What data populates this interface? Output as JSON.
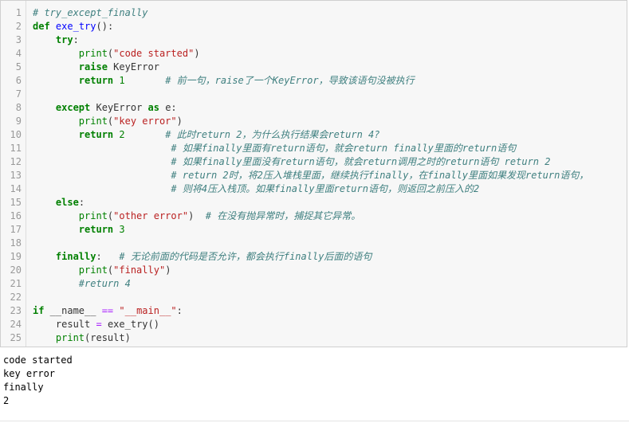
{
  "code_cell": {
    "line_numbers": [
      "1",
      "2",
      "3",
      "4",
      "5",
      "6",
      "7",
      "8",
      "9",
      "10",
      "11",
      "12",
      "13",
      "14",
      "15",
      "16",
      "17",
      "18",
      "19",
      "20",
      "21",
      "22",
      "23",
      "24",
      "25"
    ],
    "lines": [
      [
        {
          "t": "# try_except_finally",
          "c": "cm"
        }
      ],
      [
        {
          "t": "def",
          "c": "kw"
        },
        {
          "t": " ",
          "c": ""
        },
        {
          "t": "exe_try",
          "c": "fn"
        },
        {
          "t": "():",
          "c": ""
        }
      ],
      [
        {
          "t": "    ",
          "c": ""
        },
        {
          "t": "try",
          "c": "kw"
        },
        {
          "t": ":",
          "c": ""
        }
      ],
      [
        {
          "t": "        ",
          "c": ""
        },
        {
          "t": "print",
          "c": "bi"
        },
        {
          "t": "(",
          "c": ""
        },
        {
          "t": "\"code started\"",
          "c": "str"
        },
        {
          "t": ")",
          "c": ""
        }
      ],
      [
        {
          "t": "        ",
          "c": ""
        },
        {
          "t": "raise",
          "c": "kw"
        },
        {
          "t": " KeyError",
          "c": ""
        }
      ],
      [
        {
          "t": "        ",
          "c": ""
        },
        {
          "t": "return",
          "c": "kw"
        },
        {
          "t": " ",
          "c": ""
        },
        {
          "t": "1",
          "c": "num"
        },
        {
          "t": "       ",
          "c": ""
        },
        {
          "t": "# 前一句，raise了一个KeyError，导致该语句没被执行",
          "c": "cm"
        }
      ],
      [],
      [
        {
          "t": "    ",
          "c": ""
        },
        {
          "t": "except",
          "c": "kw"
        },
        {
          "t": " KeyError ",
          "c": ""
        },
        {
          "t": "as",
          "c": "kw"
        },
        {
          "t": " e:",
          "c": ""
        }
      ],
      [
        {
          "t": "        ",
          "c": ""
        },
        {
          "t": "print",
          "c": "bi"
        },
        {
          "t": "(",
          "c": ""
        },
        {
          "t": "\"key error\"",
          "c": "str"
        },
        {
          "t": ")",
          "c": ""
        }
      ],
      [
        {
          "t": "        ",
          "c": ""
        },
        {
          "t": "return",
          "c": "kw"
        },
        {
          "t": " ",
          "c": ""
        },
        {
          "t": "2",
          "c": "num"
        },
        {
          "t": "       ",
          "c": ""
        },
        {
          "t": "# 此时return 2，为什么执行结果会return 4?",
          "c": "cm"
        }
      ],
      [
        {
          "t": "                        ",
          "c": ""
        },
        {
          "t": "# 如果finally里面有return语句，就会return finally里面的return语句",
          "c": "cm"
        }
      ],
      [
        {
          "t": "                        ",
          "c": ""
        },
        {
          "t": "# 如果finally里面没有return语句，就会return调用之时的return语句 return 2",
          "c": "cm"
        }
      ],
      [
        {
          "t": "                        ",
          "c": ""
        },
        {
          "t": "# return 2时，将2压入堆栈里面，继续执行finally，在finally里面如果发现return语句，",
          "c": "cm"
        }
      ],
      [
        {
          "t": "                        ",
          "c": ""
        },
        {
          "t": "# 则将4压入栈顶。如果finally里面return语句，则返回之前压入的2",
          "c": "cm"
        }
      ],
      [
        {
          "t": "    ",
          "c": ""
        },
        {
          "t": "else",
          "c": "kw"
        },
        {
          "t": ":",
          "c": ""
        }
      ],
      [
        {
          "t": "        ",
          "c": ""
        },
        {
          "t": "print",
          "c": "bi"
        },
        {
          "t": "(",
          "c": ""
        },
        {
          "t": "\"other error\"",
          "c": "str"
        },
        {
          "t": ")  ",
          "c": ""
        },
        {
          "t": "# 在没有抛异常时，捕捉其它异常。",
          "c": "cm"
        }
      ],
      [
        {
          "t": "        ",
          "c": ""
        },
        {
          "t": "return",
          "c": "kw"
        },
        {
          "t": " ",
          "c": ""
        },
        {
          "t": "3",
          "c": "num"
        }
      ],
      [],
      [
        {
          "t": "    ",
          "c": ""
        },
        {
          "t": "finally",
          "c": "kw"
        },
        {
          "t": ":   ",
          "c": ""
        },
        {
          "t": "# 无论前面的代码是否允许，都会执行finally后面的语句",
          "c": "cm"
        }
      ],
      [
        {
          "t": "        ",
          "c": ""
        },
        {
          "t": "print",
          "c": "bi"
        },
        {
          "t": "(",
          "c": ""
        },
        {
          "t": "\"finally\"",
          "c": "str"
        },
        {
          "t": ")",
          "c": ""
        }
      ],
      [
        {
          "t": "        ",
          "c": ""
        },
        {
          "t": "#return 4",
          "c": "cm"
        }
      ],
      [],
      [
        {
          "t": "if",
          "c": "kw"
        },
        {
          "t": " __name__ ",
          "c": ""
        },
        {
          "t": "==",
          "c": "op"
        },
        {
          "t": " ",
          "c": ""
        },
        {
          "t": "\"__main__\"",
          "c": "str"
        },
        {
          "t": ":",
          "c": ""
        }
      ],
      [
        {
          "t": "    result ",
          "c": ""
        },
        {
          "t": "=",
          "c": "op"
        },
        {
          "t": " exe_try()",
          "c": ""
        }
      ],
      [
        {
          "t": "    ",
          "c": ""
        },
        {
          "t": "print",
          "c": "bi"
        },
        {
          "t": "(result)",
          "c": ""
        }
      ]
    ]
  },
  "output_cell": {
    "lines": [
      "code started",
      "key error",
      "finally",
      "2"
    ]
  }
}
